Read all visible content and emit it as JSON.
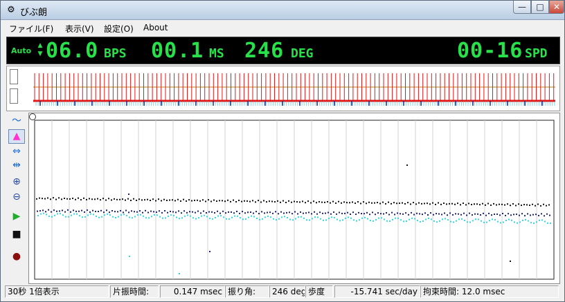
{
  "window": {
    "title": "びぶ朗",
    "min_label": "—",
    "max_label": "□",
    "close_label": "✕"
  },
  "menu": [
    {
      "label": "ファイル(F)"
    },
    {
      "label": "表示(V)"
    },
    {
      "label": "設定(O)"
    },
    {
      "label": "About"
    }
  ],
  "lcd": {
    "auto": "Auto",
    "bps_value": "06.0",
    "bps_unit": "BPS",
    "ms_value": "00.1",
    "ms_unit": "MS",
    "deg_value": "246",
    "deg_unit": "DEG",
    "spd_value": "00-16",
    "spd_unit": "SPD"
  },
  "status": {
    "seconds": "30秒 1倍表示",
    "half_label": "片振時間:",
    "half_value": "0.147 msec",
    "amp_label": "振り角:",
    "amp_value": "246 deg",
    "rate_label": "歩度",
    "rate_value": "-15.741 sec/day",
    "lock_label": "拘束時間: 12.0 msec"
  },
  "colors": {
    "lcd_green": "#27e04a",
    "trace_red": "#e01818",
    "trace_blue": "#1a2a9a",
    "dot_black": "#111111",
    "dot_navy": "#1b1e8a",
    "dot_cyan": "#35d6e0",
    "accent_magenta": "#ff33cc"
  },
  "tools": [
    {
      "name": "wave-tool-icon",
      "glyph": "〜"
    },
    {
      "name": "histogram-tool-icon",
      "glyph": "▲"
    },
    {
      "name": "expand-horizontal-icon",
      "glyph": "⇔"
    },
    {
      "name": "shrink-horizontal-icon",
      "glyph": "⇹"
    },
    {
      "name": "zoom-in-icon",
      "glyph": "⊕"
    },
    {
      "name": "zoom-out-icon",
      "glyph": "⊖"
    },
    {
      "name": "play-icon",
      "glyph": "▶"
    },
    {
      "name": "stop-icon",
      "glyph": "■"
    },
    {
      "name": "record-icon",
      "glyph": "●"
    }
  ]
}
